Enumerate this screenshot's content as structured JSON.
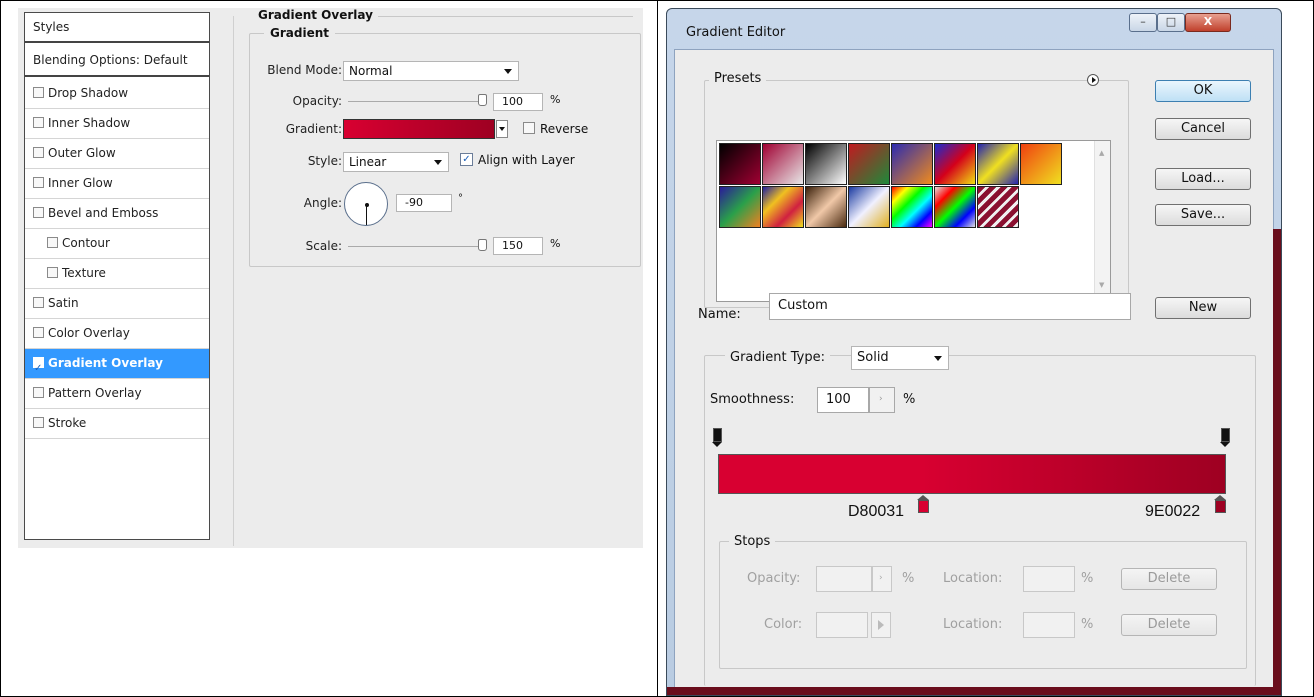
{
  "layer_style": {
    "styles_header": "Styles",
    "blending_options": "Blending Options: Default",
    "items": [
      {
        "label": "Drop Shadow",
        "checked": false,
        "indent": false
      },
      {
        "label": "Inner Shadow",
        "checked": false,
        "indent": false
      },
      {
        "label": "Outer Glow",
        "checked": false,
        "indent": false
      },
      {
        "label": "Inner Glow",
        "checked": false,
        "indent": false
      },
      {
        "label": "Bevel and Emboss",
        "checked": false,
        "indent": false
      },
      {
        "label": "Contour",
        "checked": false,
        "indent": true
      },
      {
        "label": "Texture",
        "checked": false,
        "indent": true
      },
      {
        "label": "Satin",
        "checked": false,
        "indent": false
      },
      {
        "label": "Color Overlay",
        "checked": false,
        "indent": false
      },
      {
        "label": "Gradient Overlay",
        "checked": true,
        "indent": false,
        "selected": true
      },
      {
        "label": "Pattern Overlay",
        "checked": false,
        "indent": false
      },
      {
        "label": "Stroke",
        "checked": false,
        "indent": false
      }
    ],
    "section_title": "Gradient Overlay",
    "group_title": "Gradient",
    "blend_mode_label": "Blend Mode:",
    "blend_mode_value": "Normal",
    "opacity_label": "Opacity:",
    "opacity_value": "100",
    "opacity_unit": "%",
    "gradient_label": "Gradient:",
    "reverse_label": "Reverse",
    "reverse_checked": false,
    "style_label": "Style:",
    "style_value": "Linear",
    "align_label": "Align with Layer",
    "align_checked": true,
    "angle_label": "Angle:",
    "angle_value": "-90",
    "angle_unit": "°",
    "scale_label": "Scale:",
    "scale_value": "150",
    "scale_unit": "%",
    "gradient_colors": [
      "#d80031",
      "#9e0022"
    ]
  },
  "gradient_editor": {
    "title": "Gradient Editor",
    "window_buttons": {
      "minimize": "–",
      "maximize": "□",
      "close": "X"
    },
    "presets_label": "Presets",
    "buttons": {
      "ok": "OK",
      "cancel": "Cancel",
      "load": "Load...",
      "save": "Save...",
      "new": "New"
    },
    "name_label": "Name:",
    "name_value": "Custom",
    "gradient_type_label": "Gradient Type:",
    "gradient_type_value": "Solid",
    "smoothness_label": "Smoothness:",
    "smoothness_value": "100",
    "smoothness_unit": "%",
    "stop_left_hex": "D80031",
    "stop_right_hex": "9E0022",
    "stops_label": "Stops",
    "stops_opacity_label": "Opacity:",
    "stops_opacity_unit": "%",
    "stops_location_label": "Location:",
    "stops_location_unit": "%",
    "stops_color_label": "Color:",
    "delete_label": "Delete",
    "gradient_start_color": "#d80031",
    "gradient_end_color": "#9e0022"
  }
}
